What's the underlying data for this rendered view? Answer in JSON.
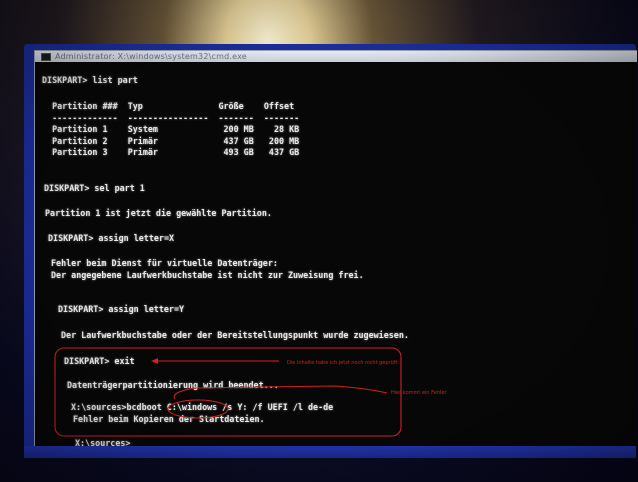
{
  "window": {
    "title": "Administrator: X:\\windows\\system32\\cmd.exe"
  },
  "console": {
    "lines": [
      "DISKPART> list part",
      "  Partition ###  Typ               Größe    Offset",
      "  -------------  ----------------  -------  -------",
      "  Partition 1    System             200 MB    28 KB",
      "  Partition 2    Primär             437 GB   200 MB",
      "  Partition 3    Primär             493 GB   437 GB",
      "DISKPART> sel part 1",
      "Partition 1 ist jetzt die gewählte Partition.",
      "DISKPART> assign letter=X",
      "Fehler beim Dienst für virtuelle Datenträger:",
      "Der angegebene Laufwerkbuchstabe ist nicht zur Zuweisung frei.",
      "DISKPART> assign letter=Y",
      "Der Laufwerkbuchstabe oder der Bereitstellungspunkt wurde zugewiesen.",
      "DISKPART> exit",
      "Datenträgerpartitionierung wird beendet...",
      "X:\\sources>bcdboot C:\\windows /s Y: /f UEFI /l de-de",
      "Fehler beim Kopieren der Startdateien.",
      "X:\\sources>"
    ]
  },
  "annotations": {
    "note1": "Die Inhalte habe ich jetzt noch nicht geprüft",
    "note2": "Hier kommt ein Fehler",
    "color": "#d0231c"
  }
}
